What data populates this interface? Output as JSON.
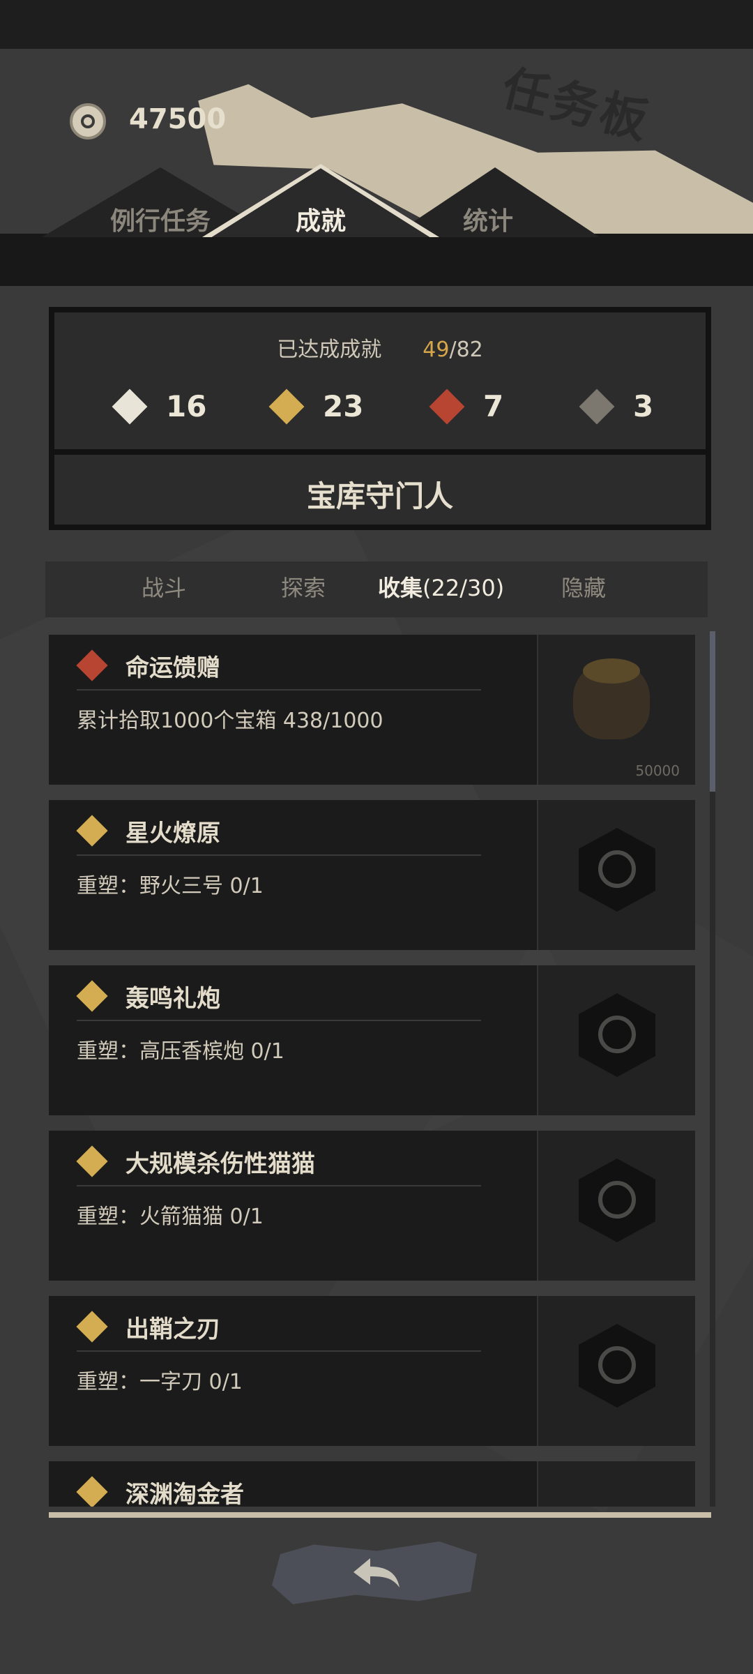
{
  "header": {
    "title": "任务板",
    "currency": {
      "icon": "coin-icon",
      "value": "47500"
    }
  },
  "tabs": [
    {
      "label": "例行任务",
      "active": false
    },
    {
      "label": "成就",
      "active": true
    },
    {
      "label": "统计",
      "active": false
    }
  ],
  "summary": {
    "label": "已达成成就",
    "achieved": "49",
    "separator": "/",
    "total": "82",
    "stats": [
      {
        "icon": "white-diamond-icon",
        "value": "16"
      },
      {
        "icon": "gold-diamond-icon",
        "value": "23"
      },
      {
        "icon": "red-diamond-icon",
        "value": "7"
      },
      {
        "icon": "hidden-diamond-icon",
        "value": "3"
      }
    ],
    "current_title": "宝库守门人"
  },
  "categories": [
    {
      "label": "战斗",
      "count": "",
      "active": false
    },
    {
      "label": "探索",
      "count": "",
      "active": false
    },
    {
      "label": "收集",
      "count": "(22/30)",
      "active": true
    },
    {
      "label": "隐藏",
      "count": "",
      "active": false
    }
  ],
  "achievements": [
    {
      "tier": "red",
      "title": "命运馈赠",
      "desc": "累计拾取1000个宝箱 438/1000",
      "reward": "gold-bag-icon",
      "reward_amount": "50000"
    },
    {
      "tier": "gold",
      "title": "星火燎原",
      "desc": "重塑：野火三号 0/1",
      "reward": "locked-emblem-icon",
      "reward_amount": ""
    },
    {
      "tier": "gold",
      "title": "轰鸣礼炮",
      "desc": "重塑：高压香槟炮 0/1",
      "reward": "locked-emblem-icon",
      "reward_amount": ""
    },
    {
      "tier": "gold",
      "title": "大规模杀伤性猫猫",
      "desc": "重塑：火箭猫猫 0/1",
      "reward": "locked-emblem-icon",
      "reward_amount": ""
    },
    {
      "tier": "gold",
      "title": "出鞘之刃",
      "desc": "重塑：一字刀 0/1",
      "reward": "locked-emblem-icon",
      "reward_amount": ""
    },
    {
      "tier": "gold",
      "title": "深渊淘金者",
      "desc": "",
      "reward": "locked-emblem-icon",
      "reward_amount": ""
    }
  ],
  "colors": {
    "gold": "#d4ac52",
    "red": "#b84532",
    "white": "#e9e4d8",
    "accent_number": "#d7a64b"
  },
  "footer": {
    "back_icon": "back-arrow-icon"
  }
}
